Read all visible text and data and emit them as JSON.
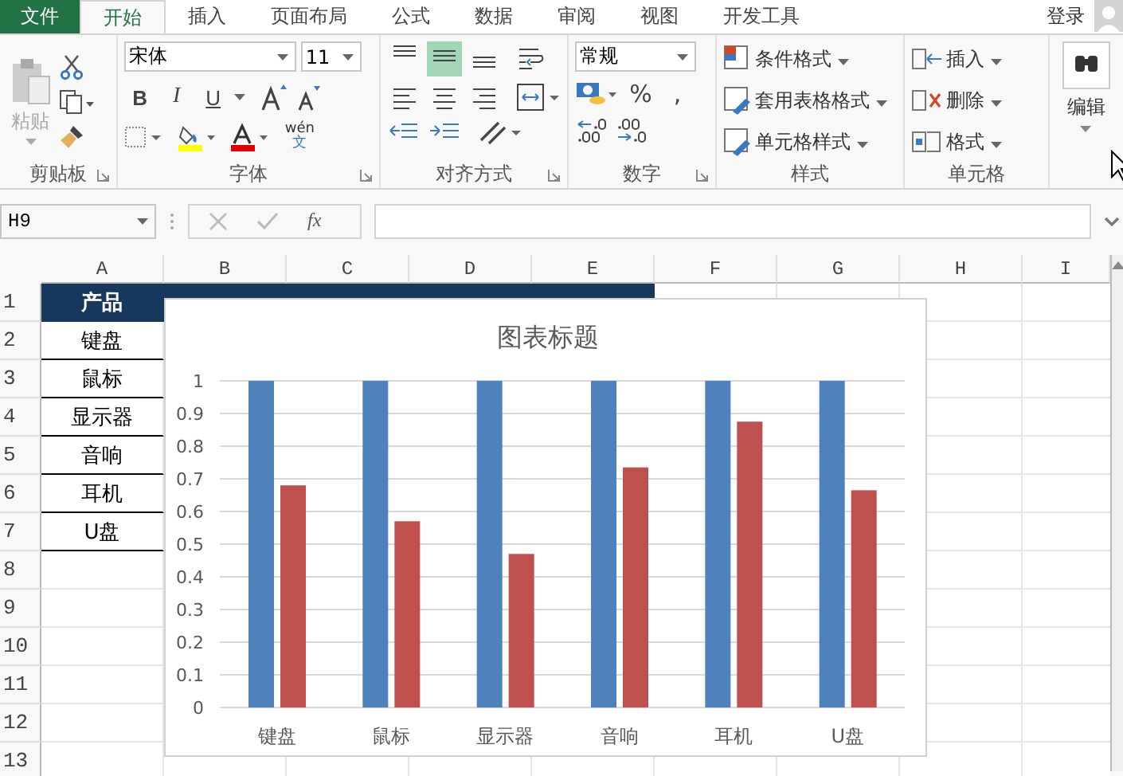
{
  "tabs": [
    {
      "label": "文件",
      "kind": "file",
      "selected": false
    },
    {
      "label": "开始",
      "kind": "tab",
      "selected": true
    },
    {
      "label": "插入",
      "kind": "tab",
      "selected": false
    },
    {
      "label": "页面布局",
      "kind": "tab",
      "selected": false
    },
    {
      "label": "公式",
      "kind": "tab",
      "selected": false
    },
    {
      "label": "数据",
      "kind": "tab",
      "selected": false
    },
    {
      "label": "审阅",
      "kind": "tab",
      "selected": false
    },
    {
      "label": "视图",
      "kind": "tab",
      "selected": false
    },
    {
      "label": "开发工具",
      "kind": "tab",
      "selected": false
    }
  ],
  "login": "登录",
  "ribbon": {
    "clipboard": {
      "label": "剪贴板",
      "paste": "粘贴"
    },
    "font": {
      "label": "字体",
      "font_name": "宋体",
      "font_size": "11",
      "bold": "B",
      "italic": "I",
      "underline": "U",
      "phonetic_top": "wén",
      "phonetic_bottom": "文"
    },
    "alignment": {
      "label": "对齐方式",
      "vertical": [
        {
          "kind": "top",
          "selected": false
        },
        {
          "kind": "middle",
          "selected": true
        },
        {
          "kind": "bottom",
          "selected": false
        }
      ]
    },
    "number": {
      "label": "数字",
      "format": "常规",
      "percent": "%",
      "comma": ","
    },
    "styles": {
      "label": "样式",
      "items": [
        "条件格式",
        "套用表格格式",
        "单元格样式"
      ]
    },
    "cells": {
      "label": "单元格",
      "items": [
        "插入",
        "删除",
        "格式"
      ]
    },
    "editing": {
      "label": "编辑"
    }
  },
  "formula_bar": {
    "name_box": "H9",
    "fx": "fx"
  },
  "sheet": {
    "columns": [
      "A",
      "B",
      "C",
      "D",
      "E",
      "F",
      "G",
      "H",
      "I"
    ],
    "rows": [
      "1",
      "2",
      "3",
      "4",
      "5",
      "6",
      "7",
      "8",
      "9",
      "10",
      "11",
      "12",
      "13"
    ],
    "column_a": [
      {
        "text": "产品",
        "kind": "header"
      },
      {
        "text": "键盘",
        "kind": "cell"
      },
      {
        "text": "鼠标",
        "kind": "cell"
      },
      {
        "text": "显示器",
        "kind": "cell"
      },
      {
        "text": "音响",
        "kind": "cell"
      },
      {
        "text": "耳机",
        "kind": "cell"
      },
      {
        "text": "U盘",
        "kind": "cell"
      }
    ]
  },
  "chart": {
    "chart_data": {
      "type": "bar",
      "title": "图表标题",
      "categories": [
        "键盘",
        "鼠标",
        "显示器",
        "音响",
        "耳机",
        "U盘"
      ],
      "series": [
        {
          "color": "#4f81bd",
          "values": [
            1,
            1,
            1,
            1,
            1,
            1
          ]
        },
        {
          "color": "#c0504d",
          "values": [
            0.68,
            0.57,
            0.47,
            0.735,
            0.875,
            0.665
          ]
        }
      ],
      "ylim": [
        0,
        1
      ],
      "grid": true,
      "yticks": [
        0,
        0.1,
        0.2,
        0.3,
        0.4,
        0.5,
        0.6,
        0.7,
        0.8,
        0.9,
        1
      ]
    }
  }
}
